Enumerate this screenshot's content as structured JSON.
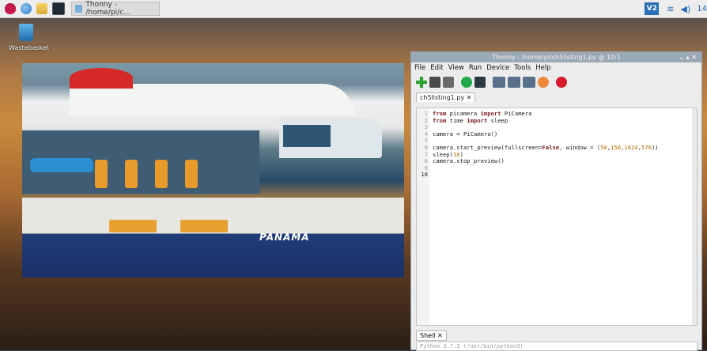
{
  "taskbar": {
    "task_label": "Thonny - /home/pi/c...",
    "clock": "14",
    "vnc_label": "V2"
  },
  "desktop": {
    "wastebasket_label": "Wastebasket"
  },
  "preview": {
    "ship_name": "PANAMA"
  },
  "thonny": {
    "title": "Thonny - /home/pi/ch5listing1.py @ 10:1",
    "controls": "⌄ ▴ ✕",
    "menu": [
      "File",
      "Edit",
      "View",
      "Run",
      "Device",
      "Tools",
      "Help"
    ],
    "file_tab": "ch5listing1.py ✕",
    "shell_tab": "Shell ✕",
    "shell_text": "Python 3.7.3 (/usr/bin/python3)",
    "code_lines": [
      {
        "n": "1",
        "text": "from picamera import PiCamera"
      },
      {
        "n": "2",
        "text": "from time import sleep"
      },
      {
        "n": "3",
        "text": ""
      },
      {
        "n": "4",
        "text": "camera = PiCamera()"
      },
      {
        "n": "5",
        "text": ""
      },
      {
        "n": "6",
        "text": "camera.start_preview(fullscreen=False, window = (50,150,1024,576))"
      },
      {
        "n": "7",
        "text": "sleep(10)"
      },
      {
        "n": "8",
        "text": "camera.stop_preview()"
      },
      {
        "n": "9",
        "text": ""
      },
      {
        "n": "10",
        "text": ""
      }
    ]
  }
}
